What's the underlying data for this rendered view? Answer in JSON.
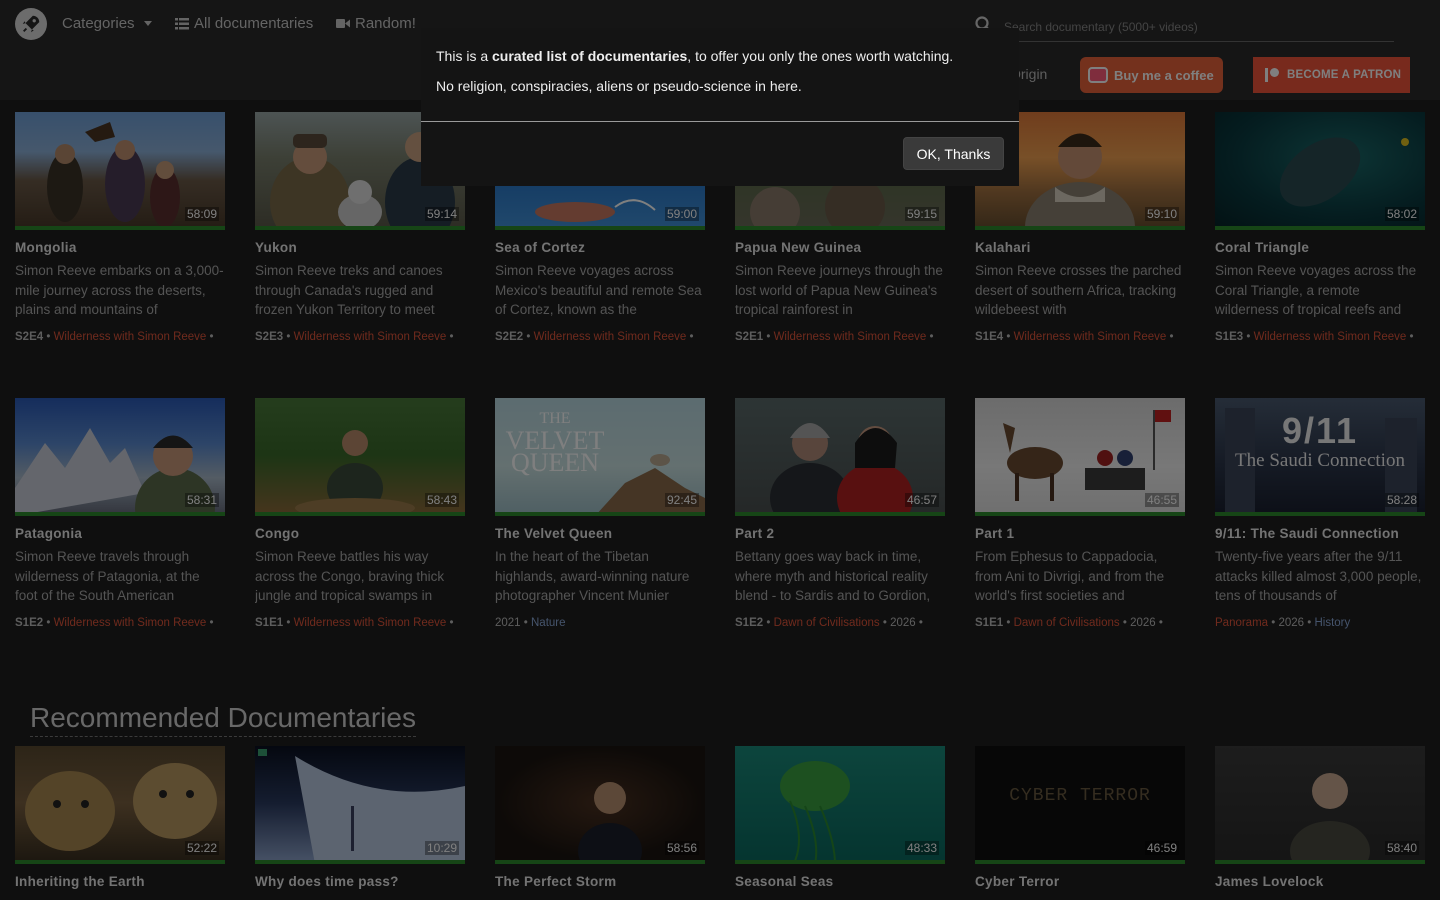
{
  "nav": {
    "categories": "Categories",
    "all_documentaries": "All documentaries",
    "random": "Random!",
    "search_placeholder": "Search documentary (5000+ videos)",
    "origin": "Origin",
    "coffee": "Buy me a coffee",
    "patron": "BECOME A PATRON"
  },
  "modal": {
    "line1_prefix": "This is a ",
    "line1_bold": "curated list of documentaries",
    "line1_suffix": ", to offer you only the ones worth watching.",
    "line2": "No religion, conspiracies, aliens or pseudo-science in here.",
    "ok": "OK, Thanks"
  },
  "row1": [
    {
      "title": "Mongolia",
      "duration": "58:09",
      "desc": "Simon Reeve embarks on a 3,000-mile journey across the deserts, plains and mountains of",
      "ep": "S2E4",
      "series": "Wilderness with Simon Reeve",
      "tail": " •"
    },
    {
      "title": "Yukon",
      "duration": "59:14",
      "desc": "Simon Reeve treks and canoes through Canada's rugged and frozen Yukon Territory to meet",
      "ep": "S2E3",
      "series": "Wilderness with Simon Reeve",
      "tail": " •"
    },
    {
      "title": "Sea of Cortez",
      "duration": "59:00",
      "desc": "Simon Reeve voyages across Mexico's beautiful and remote Sea of Cortez, known as the",
      "ep": "S2E2",
      "series": "Wilderness with Simon Reeve",
      "tail": " •"
    },
    {
      "title": "Papua New Guinea",
      "duration": "59:15",
      "desc": "Simon Reeve journeys through the lost world of Papua New Guinea's tropical rainforest in",
      "ep": "S2E1",
      "series": "Wilderness with Simon Reeve",
      "tail": " •"
    },
    {
      "title": "Kalahari",
      "duration": "59:10",
      "desc": "Simon Reeve crosses the parched desert of southern Africa, tracking wildebeest with",
      "ep": "S1E4",
      "series": "Wilderness with Simon Reeve",
      "tail": " •"
    },
    {
      "title": "Coral Triangle",
      "duration": "58:02",
      "desc": "Simon Reeve voyages across the Coral Triangle, a remote wilderness of tropical reefs and",
      "ep": "S1E3",
      "series": "Wilderness with Simon Reeve",
      "tail": " •"
    }
  ],
  "row2": [
    {
      "title": "Patagonia",
      "duration": "58:31",
      "desc": "Simon Reeve travels through wilderness of Patagonia, at the foot of the South American",
      "ep": "S1E2",
      "series": "Wilderness with Simon Reeve",
      "tail": " •",
      "year": "",
      "genre": ""
    },
    {
      "title": "Congo",
      "duration": "58:43",
      "desc": "Simon Reeve battles his way across the Congo, braving thick jungle and tropical swamps in",
      "ep": "S1E1",
      "series": "Wilderness with Simon Reeve",
      "tail": " •",
      "year": "",
      "genre": ""
    },
    {
      "title": "The Velvet Queen",
      "duration": "92:45",
      "desc": "In the heart of the Tibetan highlands, award-winning nature photographer Vincent Munier",
      "ep": "",
      "series": "",
      "tail": "",
      "year": "2021 • ",
      "genre": "Nature"
    },
    {
      "title": "Part 2",
      "duration": "46:57",
      "desc": "Bettany goes way back in time, where myth and historical reality blend - to Sardis and to Gordion,",
      "ep": "S1E2",
      "series": "Dawn of Civilisations",
      "tail": " • 2026 •",
      "year": "",
      "genre": ""
    },
    {
      "title": "Part 1",
      "duration": "46:55",
      "desc": "From Ephesus to Cappadocia, from Ani to Divrigi, and from the world's first societies and",
      "ep": "S1E1",
      "series": "Dawn of Civilisations",
      "tail": " • 2026 •",
      "year": "",
      "genre": ""
    },
    {
      "title": "9/11: The Saudi Connection",
      "duration": "58:28",
      "desc": "Twenty-five years after the 9/11 attacks killed almost 3,000 people, tens of thousands of",
      "ep": "",
      "series": "Panorama",
      "tail": " • 2026 • ",
      "year": "",
      "genre": "History"
    }
  ],
  "recommended_heading": "Recommended Documentaries",
  "row3": [
    {
      "title": "Inheriting the Earth",
      "duration": "52:22"
    },
    {
      "title": "Why does time pass?",
      "duration": "10:29"
    },
    {
      "title": "The Perfect Storm",
      "duration": "58:56"
    },
    {
      "title": "Seasonal Seas",
      "duration": "48:33"
    },
    {
      "title": "Cyber Terror",
      "duration": "46:59"
    },
    {
      "title": "James Lovelock",
      "duration": "58:40"
    }
  ],
  "thumb_text": {
    "velvet_queen_line1": "THE",
    "velvet_queen_line2": "VELVET",
    "velvet_queen_line3": "QUEEN",
    "saudi_line1": "9/11",
    "saudi_line2": "The Saudi Connection",
    "cyber": "CYBER TERROR"
  }
}
